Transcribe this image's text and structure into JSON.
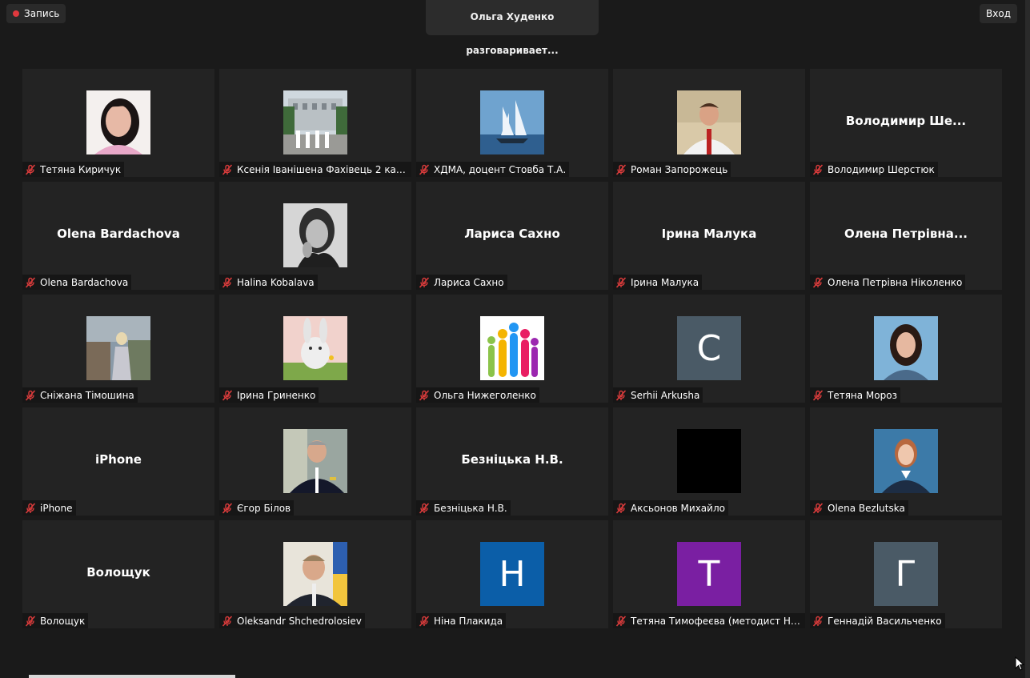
{
  "top": {
    "record_label": "Запись",
    "speaker_text": "Ольга Худенко разговаривает...",
    "login_label": "Вход"
  },
  "participants": [
    {
      "label": "Тетяна Киричук",
      "avatar": "photo-woman"
    },
    {
      "label": "Ксенія Іванішена Фахівець 2 кат. В...",
      "avatar": "photo-building"
    },
    {
      "label": "ХДМА, доцент Стовба Т.А.",
      "avatar": "photo-ship"
    },
    {
      "label": "Роман Запорожець",
      "avatar": "photo-man"
    },
    {
      "label": "Володимир Шерстюк",
      "big_name": "Володимир  Ше..."
    },
    {
      "label": "Olena Bardachova",
      "big_name": "Olena Bardachova"
    },
    {
      "label": "Halina Kobalava",
      "avatar": "photo-bw"
    },
    {
      "label": "Лариса Сахно",
      "big_name": "Лариса Сахно"
    },
    {
      "label": "Ірина Малука",
      "big_name": "Ірина Малука"
    },
    {
      "label": "Олена Петрівна Ніколенко",
      "big_name": "Олена  Петрівна..."
    },
    {
      "label": "Сніжана Тімошина",
      "avatar": "photo-outdoor"
    },
    {
      "label": "Ірина Гриненко",
      "avatar": "photo-bunny"
    },
    {
      "label": "Ольга Нижеголенко",
      "avatar": "photo-figures"
    },
    {
      "label": "Serhii Arkusha",
      "letter": "C",
      "color": "#4a5a66"
    },
    {
      "label": "Тетяна Мороз",
      "avatar": "photo-woman2"
    },
    {
      "label": "iPhone",
      "big_name": "iPhone"
    },
    {
      "label": "Єгор Білов",
      "avatar": "photo-captain"
    },
    {
      "label": "Безніцька Н.В.",
      "big_name": "Безніцька Н.В."
    },
    {
      "label": "Аксьонов Михайло",
      "avatar": "black"
    },
    {
      "label": "Olena Bezlutska",
      "avatar": "photo-uniform"
    },
    {
      "label": "Волощук",
      "big_name": "Волощук"
    },
    {
      "label": "Oleksandr Shchedrolosiev",
      "avatar": "photo-flag"
    },
    {
      "label": "Ніна Плакида",
      "letter": "H",
      "color": "#0b5ea8"
    },
    {
      "label": "Тетяна Тимофеєва (методист НМВ...",
      "letter": "T",
      "color": "#7a1fa2"
    },
    {
      "label": "Геннадій Васильченко",
      "letter": "Г",
      "color": "#4a5a66"
    }
  ],
  "colors": {
    "background": "#1a1a1a",
    "tile": "#232323",
    "muted_mic": "#d83b3b",
    "record_dot": "#e0393e"
  }
}
